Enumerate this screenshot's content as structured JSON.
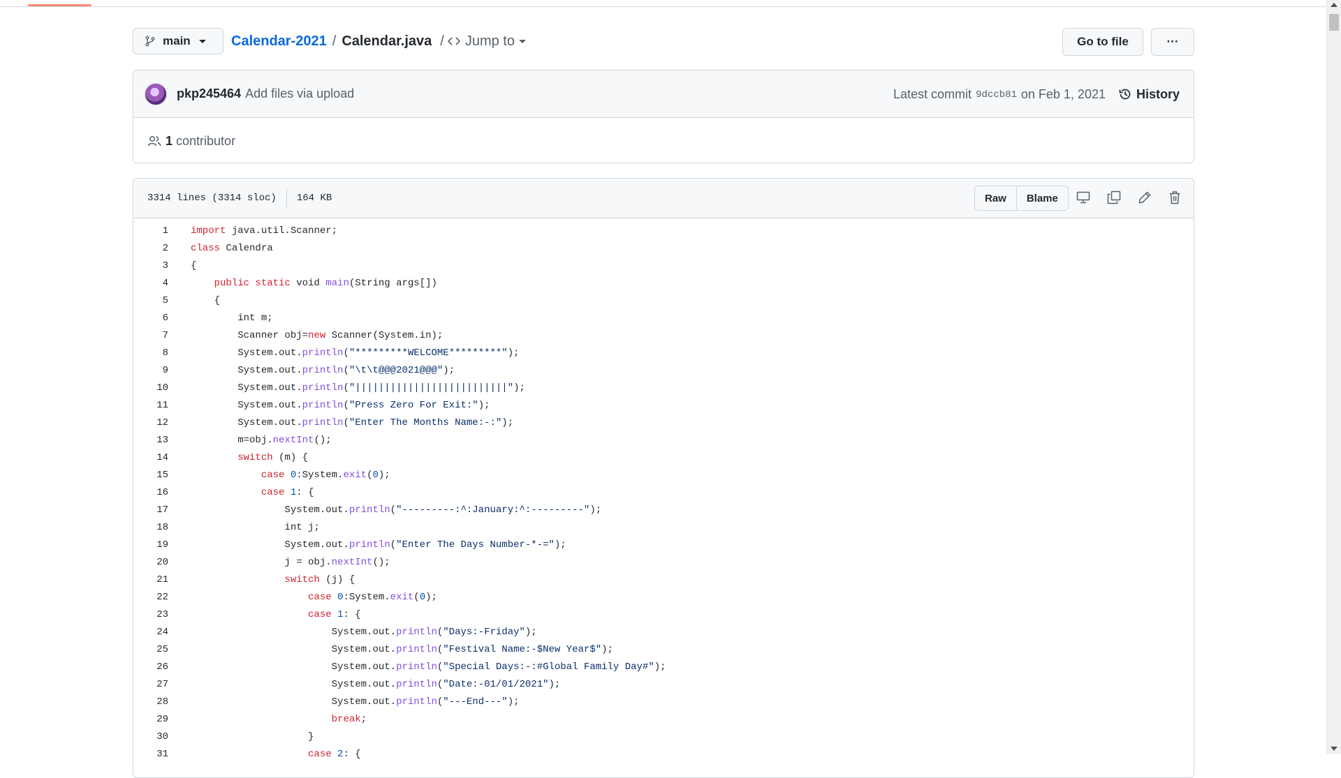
{
  "nav": {
    "branch": "main",
    "repo": "Calendar-2021",
    "separator": "/",
    "file": "Calendar.java",
    "jump_sep": "/",
    "jump_to": "Jump to",
    "go_to_file": "Go to file",
    "more": "···"
  },
  "commit": {
    "author": "pkp245464",
    "message": "Add files via upload",
    "latest_prefix": "Latest commit",
    "sha": "9dccb81",
    "date": "on Feb 1, 2021",
    "history": "History",
    "contributors_count": "1",
    "contributors_label": "contributor"
  },
  "file": {
    "lines": "3314 lines (3314 sloc)",
    "size": "164 KB",
    "raw": "Raw",
    "blame": "Blame"
  },
  "code": [
    [
      [
        "kw",
        "import"
      ],
      [
        "t",
        " java.util.Scanner;"
      ]
    ],
    [
      [
        "kw",
        "class"
      ],
      [
        "t",
        " Calendra"
      ]
    ],
    [
      [
        "t",
        "{"
      ]
    ],
    [
      [
        "t",
        "    "
      ],
      [
        "kw",
        "public static"
      ],
      [
        "t",
        " void "
      ],
      [
        "fn",
        "main"
      ],
      [
        "t",
        "(String args[])"
      ]
    ],
    [
      [
        "t",
        "    {"
      ]
    ],
    [
      [
        "t",
        "        int m;"
      ]
    ],
    [
      [
        "t",
        "        Scanner obj="
      ],
      [
        "kw",
        "new"
      ],
      [
        "t",
        " Scanner(System.in);"
      ]
    ],
    [
      [
        "t",
        "        System.out."
      ],
      [
        "fn",
        "println"
      ],
      [
        "t",
        "("
      ],
      [
        "str",
        "\"*********WELCOME*********\""
      ],
      [
        "t",
        ");"
      ]
    ],
    [
      [
        "t",
        "        System.out."
      ],
      [
        "fn",
        "println"
      ],
      [
        "t",
        "("
      ],
      [
        "str",
        "\"\\t\\t@@@2021@@@\""
      ],
      [
        "t",
        ");"
      ]
    ],
    [
      [
        "t",
        "        System.out."
      ],
      [
        "fn",
        "println"
      ],
      [
        "t",
        "("
      ],
      [
        "str",
        "\"||||||||||||||||||||||||||\""
      ],
      [
        "t",
        ");"
      ]
    ],
    [
      [
        "t",
        "        System.out."
      ],
      [
        "fn",
        "println"
      ],
      [
        "t",
        "("
      ],
      [
        "str",
        "\"Press Zero For Exit:\""
      ],
      [
        "t",
        ");"
      ]
    ],
    [
      [
        "t",
        "        System.out."
      ],
      [
        "fn",
        "println"
      ],
      [
        "t",
        "("
      ],
      [
        "str",
        "\"Enter The Months Name:-:\""
      ],
      [
        "t",
        ");"
      ]
    ],
    [
      [
        "t",
        "        m=obj."
      ],
      [
        "fn",
        "nextInt"
      ],
      [
        "t",
        "();"
      ]
    ],
    [
      [
        "t",
        "        "
      ],
      [
        "kw",
        "switch"
      ],
      [
        "t",
        " (m) {"
      ]
    ],
    [
      [
        "t",
        "            "
      ],
      [
        "kw",
        "case"
      ],
      [
        "t",
        " "
      ],
      [
        "num",
        "0"
      ],
      [
        "t",
        ":System."
      ],
      [
        "fn",
        "exit"
      ],
      [
        "t",
        "("
      ],
      [
        "num",
        "0"
      ],
      [
        "t",
        ");"
      ]
    ],
    [
      [
        "t",
        "            "
      ],
      [
        "kw",
        "case"
      ],
      [
        "t",
        " "
      ],
      [
        "num",
        "1"
      ],
      [
        "t",
        ": {"
      ]
    ],
    [
      [
        "t",
        "                System.out."
      ],
      [
        "fn",
        "println"
      ],
      [
        "t",
        "("
      ],
      [
        "str",
        "\"---------:^:January:^:---------\""
      ],
      [
        "t",
        ");"
      ]
    ],
    [
      [
        "t",
        "                int j;"
      ]
    ],
    [
      [
        "t",
        "                System.out."
      ],
      [
        "fn",
        "println"
      ],
      [
        "t",
        "("
      ],
      [
        "str",
        "\"Enter The Days Number-*-=\""
      ],
      [
        "t",
        ");"
      ]
    ],
    [
      [
        "t",
        "                j = obj."
      ],
      [
        "fn",
        "nextInt"
      ],
      [
        "t",
        "();"
      ]
    ],
    [
      [
        "t",
        "                "
      ],
      [
        "kw",
        "switch"
      ],
      [
        "t",
        " (j) {"
      ]
    ],
    [
      [
        "t",
        "                    "
      ],
      [
        "kw",
        "case"
      ],
      [
        "t",
        " "
      ],
      [
        "num",
        "0"
      ],
      [
        "t",
        ":System."
      ],
      [
        "fn",
        "exit"
      ],
      [
        "t",
        "("
      ],
      [
        "num",
        "0"
      ],
      [
        "t",
        ");"
      ]
    ],
    [
      [
        "t",
        "                    "
      ],
      [
        "kw",
        "case"
      ],
      [
        "t",
        " "
      ],
      [
        "num",
        "1"
      ],
      [
        "t",
        ": {"
      ]
    ],
    [
      [
        "t",
        "                        System.out."
      ],
      [
        "fn",
        "println"
      ],
      [
        "t",
        "("
      ],
      [
        "str",
        "\"Days:-Friday\""
      ],
      [
        "t",
        ");"
      ]
    ],
    [
      [
        "t",
        "                        System.out."
      ],
      [
        "fn",
        "println"
      ],
      [
        "t",
        "("
      ],
      [
        "str",
        "\"Festival Name:-$New Year$\""
      ],
      [
        "t",
        ");"
      ]
    ],
    [
      [
        "t",
        "                        System.out."
      ],
      [
        "fn",
        "println"
      ],
      [
        "t",
        "("
      ],
      [
        "str",
        "\"Special Days:-:#Global Family Day#\""
      ],
      [
        "t",
        ");"
      ]
    ],
    [
      [
        "t",
        "                        System.out."
      ],
      [
        "fn",
        "println"
      ],
      [
        "t",
        "("
      ],
      [
        "str",
        "\"Date:-01/01/2021\""
      ],
      [
        "t",
        ");"
      ]
    ],
    [
      [
        "t",
        "                        System.out."
      ],
      [
        "fn",
        "println"
      ],
      [
        "t",
        "("
      ],
      [
        "str",
        "\"---End---\""
      ],
      [
        "t",
        ");"
      ]
    ],
    [
      [
        "t",
        "                        "
      ],
      [
        "kw",
        "break"
      ],
      [
        "t",
        ";"
      ]
    ],
    [
      [
        "t",
        "                    }"
      ]
    ],
    [
      [
        "t",
        "                    "
      ],
      [
        "kw",
        "case"
      ],
      [
        "t",
        " "
      ],
      [
        "num",
        "2"
      ],
      [
        "t",
        ": {"
      ]
    ]
  ]
}
